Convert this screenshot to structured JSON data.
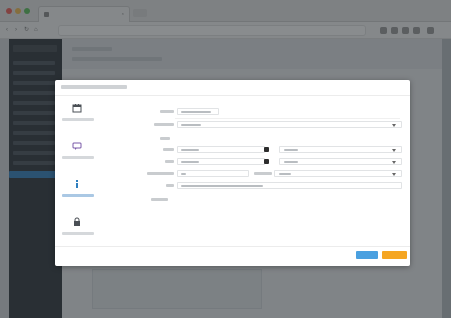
{
  "browser": {
    "tab_title": "",
    "traffic_lights": {
      "close": "#f25c54",
      "minimize": "#f5bd4f",
      "maximize": "#5ac05a"
    }
  },
  "colors": {
    "sidebar": "#2b3238",
    "sidebar_active": "#2f7fbf",
    "primary_button": "#4aa0e0",
    "accent_button": "#f5a623"
  },
  "icons": {
    "step_1": "calendar-icon",
    "step_2": "chat-icon",
    "step_3": "info-icon",
    "step_4": "lock-icon"
  },
  "wizard": {
    "active_step": 3,
    "steps": [
      {
        "icon": "calendar-icon"
      },
      {
        "icon": "chat-icon"
      },
      {
        "icon": "info-icon"
      },
      {
        "icon": "lock-icon"
      }
    ]
  }
}
